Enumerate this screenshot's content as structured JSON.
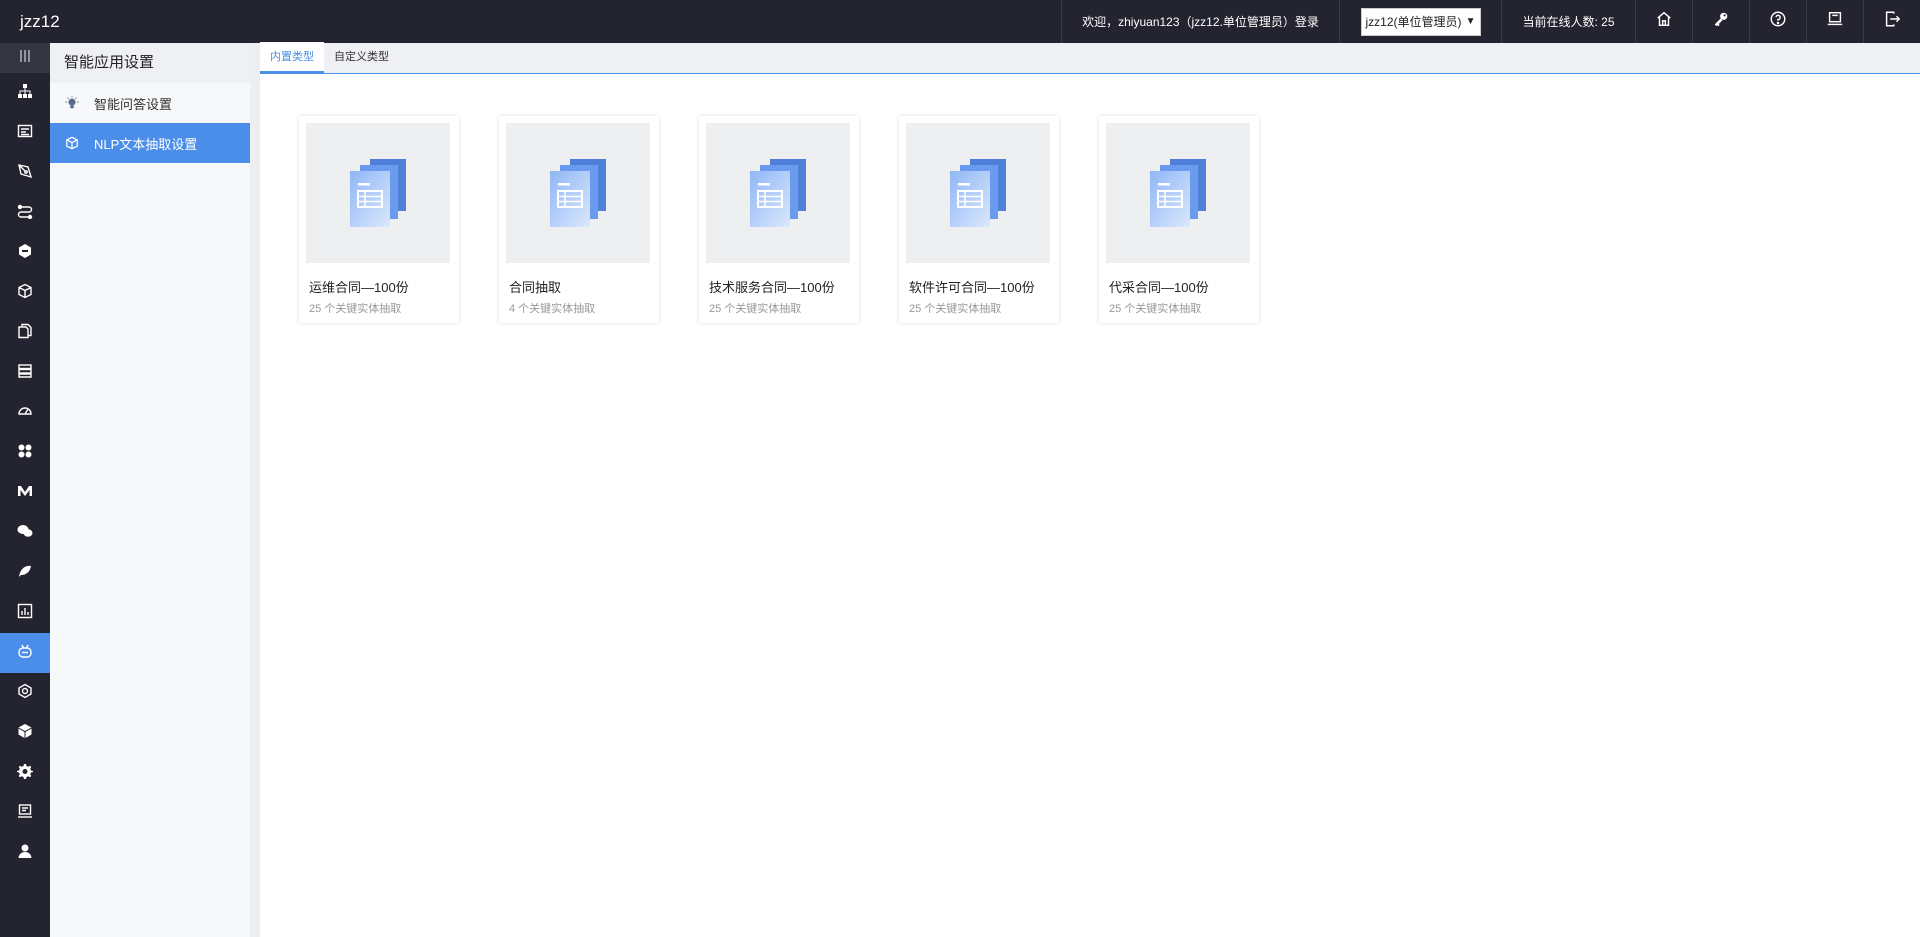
{
  "app": {
    "title": "jzz12"
  },
  "topbar": {
    "welcome": "欢迎，zhiyuan123（jzz12.单位管理员）登录",
    "unit_select": "jzz12(单位管理员)",
    "online_users": "当前在线人数: 25",
    "icons": [
      "home-icon",
      "key-icon",
      "help-icon",
      "monitor-icon",
      "logout-icon"
    ]
  },
  "iconbar": {
    "items": [
      "menu-toggle-icon",
      "org-tree-icon",
      "form-icon",
      "pen-icon",
      "flow-icon",
      "hexagon-icon",
      "cube-icon",
      "documents-icon",
      "layers-icon",
      "dashboard-icon",
      "apps-icon",
      "mail-m-icon",
      "wechat-icon",
      "leaf-icon",
      "report-chart-icon",
      "robot-icon",
      "settings-hex-icon",
      "box-icon",
      "gear-icon",
      "computer-icon",
      "user-icon"
    ],
    "active": "robot-icon"
  },
  "sidebar": {
    "title": "智能应用设置",
    "items": [
      {
        "label": "智能问答设置",
        "icon": "lightbulb-icon",
        "active": false
      },
      {
        "label": "NLP文本抽取设置",
        "icon": "cube-icon",
        "active": true
      }
    ]
  },
  "tabs": [
    {
      "label": "内置类型",
      "active": true
    },
    {
      "label": "自定义类型",
      "active": false
    }
  ],
  "cards": [
    {
      "title": "运维合同—100份",
      "subtitle": "25 个关键实体抽取"
    },
    {
      "title": "合同抽取",
      "subtitle": "4 个关键实体抽取"
    },
    {
      "title": "技术服务合同—100份",
      "subtitle": "25 个关键实体抽取"
    },
    {
      "title": "软件许可合同—100份",
      "subtitle": "25 个关键实体抽取"
    },
    {
      "title": "代采合同—100份",
      "subtitle": "25 个关键实体抽取"
    }
  ],
  "colors": {
    "topbar": "#23242f",
    "accent": "#4a8ee9"
  }
}
